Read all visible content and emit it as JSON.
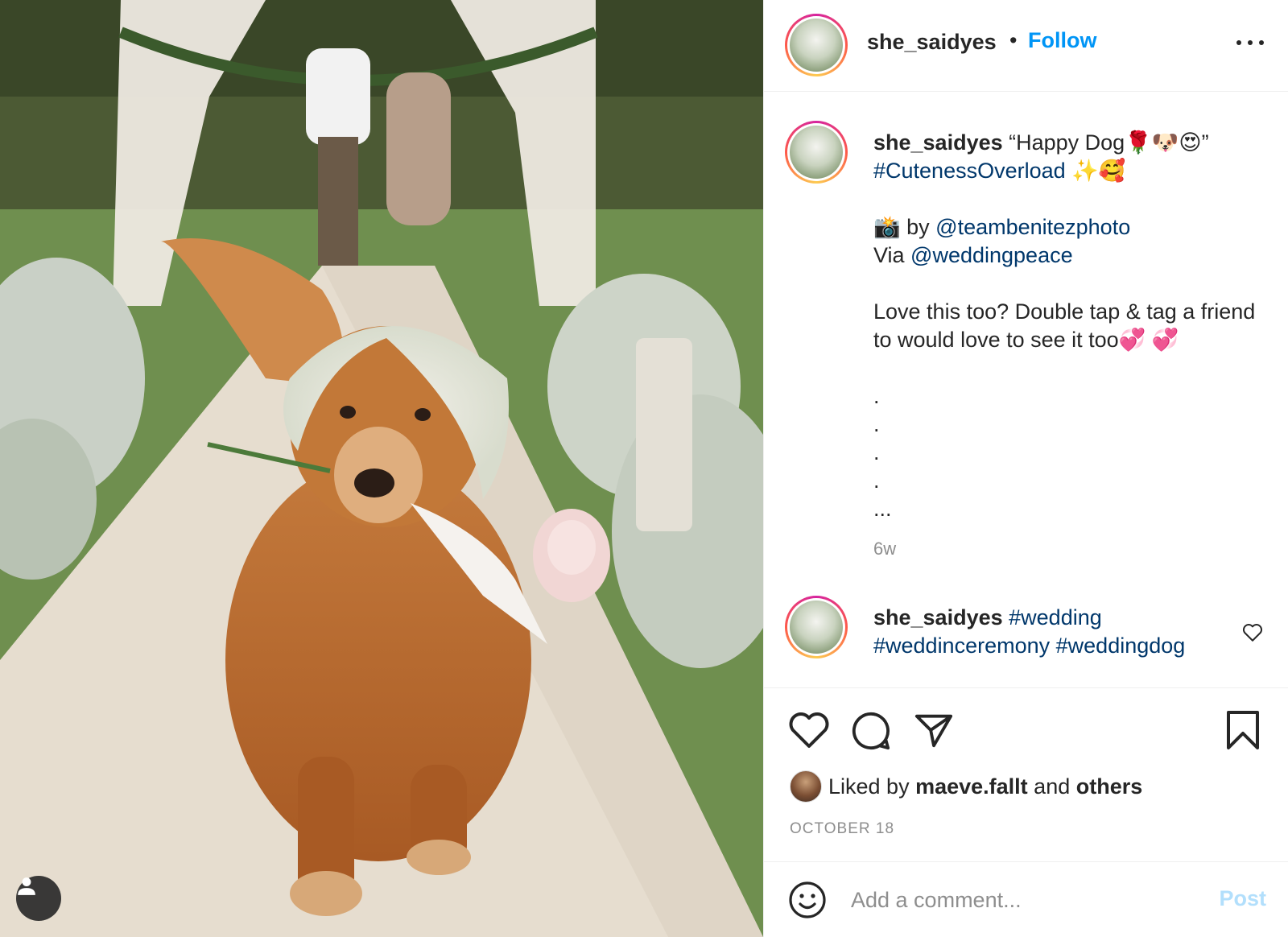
{
  "post": {
    "username": "she_saidyes",
    "follow_label": "Follow",
    "separator": "•",
    "more_icon": "more-horizontal-icon"
  },
  "caption": {
    "username": "she_saidyes",
    "line1": " “Happy Dog🌹🐶😍”",
    "hashtag": "#CutenessOverload",
    "hashtag_emoji": " ✨🥰",
    "camera": "📸",
    "by_label": " by ",
    "photo_credit": "@teambenitezphoto",
    "via_label": "Via ",
    "via_handle": "@weddingpeace",
    "body": "Love this too? Double tap & tag a friend to would love to see it too💞 💞",
    "dots": ".\n.\n.\n.\n...",
    "age": "6w"
  },
  "comment": {
    "username": "she_saidyes",
    "tag1": "#wedding",
    "tag2": "#weddinceremony",
    "tag3": "#weddingdog"
  },
  "likes": {
    "prefix": "Liked by ",
    "user": "maeve.fallt",
    "middle": " and ",
    "others": "others"
  },
  "date": "OCTOBER 18",
  "add_comment": {
    "placeholder": "Add a comment...",
    "post_label": "Post"
  },
  "colors": {
    "accent": "#0095f6",
    "link": "#00376b",
    "muted": "#8e8e8e",
    "post_disabled": "#b2dffc"
  }
}
